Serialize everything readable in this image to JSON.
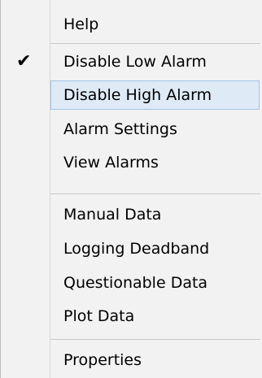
{
  "menu": {
    "items": [
      {
        "label": "Help"
      },
      {
        "label": "Disable Low Alarm",
        "checked": true
      },
      {
        "label": "Disable High Alarm",
        "highlighted": true
      },
      {
        "label": "Alarm Settings"
      },
      {
        "label": "View Alarms"
      },
      {
        "label": "Manual Data"
      },
      {
        "label": "Logging Deadband"
      },
      {
        "label": "Questionable Data"
      },
      {
        "label": "Plot Data"
      },
      {
        "label": "Properties"
      }
    ],
    "check_glyph": "✔",
    "colors": {
      "background": "#f2f2f2",
      "highlight_fill": "#dfeaf7",
      "highlight_border": "#9dc3e8",
      "separator": "#c8c8c8"
    }
  }
}
